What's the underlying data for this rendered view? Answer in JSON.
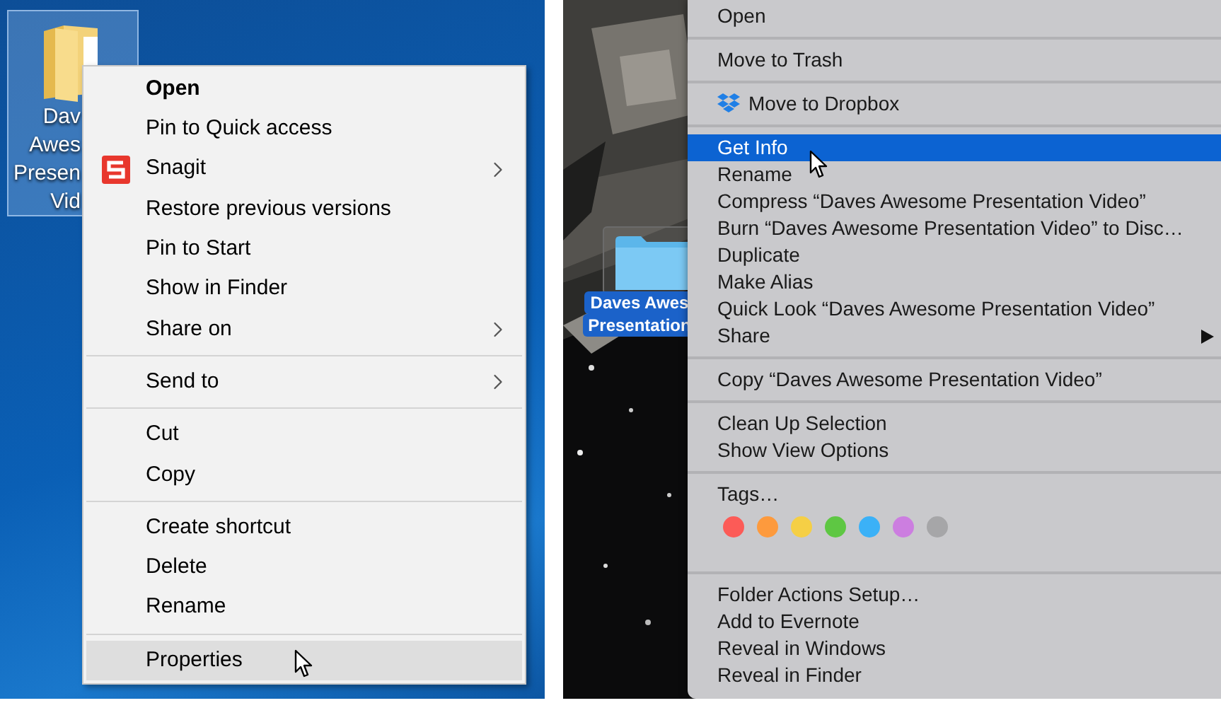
{
  "windows": {
    "desktop_icon": {
      "selected": true,
      "label_lines": [
        "Dav",
        "Awes",
        "Presen",
        "Vid"
      ]
    },
    "menu": {
      "items": [
        {
          "kind": "item",
          "label": "Open",
          "bold": true,
          "has_icon": false,
          "submenu": false,
          "selected": false
        },
        {
          "kind": "item",
          "label": "Pin to Quick access",
          "bold": false,
          "has_icon": false,
          "submenu": false,
          "selected": false
        },
        {
          "kind": "item",
          "label": "Snagit",
          "bold": false,
          "has_icon": true,
          "submenu": true,
          "selected": false
        },
        {
          "kind": "item",
          "label": "Restore previous versions",
          "bold": false,
          "has_icon": false,
          "submenu": false,
          "selected": false
        },
        {
          "kind": "item",
          "label": "Pin to Start",
          "bold": false,
          "has_icon": false,
          "submenu": false,
          "selected": false
        },
        {
          "kind": "item",
          "label": "Show in Finder",
          "bold": false,
          "has_icon": false,
          "submenu": false,
          "selected": false
        },
        {
          "kind": "item",
          "label": "Share on",
          "bold": false,
          "has_icon": false,
          "submenu": true,
          "selected": false
        },
        {
          "kind": "separator"
        },
        {
          "kind": "item",
          "label": "Send to",
          "bold": false,
          "has_icon": false,
          "submenu": true,
          "selected": false
        },
        {
          "kind": "separator"
        },
        {
          "kind": "item",
          "label": "Cut",
          "bold": false,
          "has_icon": false,
          "submenu": false,
          "selected": false
        },
        {
          "kind": "item",
          "label": "Copy",
          "bold": false,
          "has_icon": false,
          "submenu": false,
          "selected": false
        },
        {
          "kind": "separator"
        },
        {
          "kind": "item",
          "label": "Create shortcut",
          "bold": false,
          "has_icon": false,
          "submenu": false,
          "selected": false
        },
        {
          "kind": "item",
          "label": "Delete",
          "bold": false,
          "has_icon": false,
          "submenu": false,
          "selected": false
        },
        {
          "kind": "item",
          "label": "Rename",
          "bold": false,
          "has_icon": false,
          "submenu": false,
          "selected": false
        },
        {
          "kind": "separator"
        },
        {
          "kind": "item",
          "label": "Properties",
          "bold": false,
          "has_icon": false,
          "submenu": false,
          "selected": true
        }
      ]
    }
  },
  "mac": {
    "desktop_icon": {
      "selected": true,
      "label_lines": [
        "Daves Awes",
        "Presentation"
      ]
    },
    "menu": {
      "items": [
        {
          "kind": "item",
          "label": "Open",
          "has_icon": false,
          "submenu": false,
          "selected": false
        },
        {
          "kind": "separator"
        },
        {
          "kind": "item",
          "label": "Move to Trash",
          "has_icon": false,
          "submenu": false,
          "selected": false
        },
        {
          "kind": "separator"
        },
        {
          "kind": "item",
          "label": "Move to Dropbox",
          "has_icon": true,
          "submenu": false,
          "selected": false
        },
        {
          "kind": "separator"
        },
        {
          "kind": "item",
          "label": "Get Info",
          "has_icon": false,
          "submenu": false,
          "selected": true
        },
        {
          "kind": "item",
          "label": "Rename",
          "has_icon": false,
          "submenu": false,
          "selected": false
        },
        {
          "kind": "item",
          "label": "Compress “Daves Awesome Presentation Video”",
          "has_icon": false,
          "submenu": false,
          "selected": false
        },
        {
          "kind": "item",
          "label": "Burn “Daves Awesome Presentation Video” to Disc…",
          "has_icon": false,
          "submenu": false,
          "selected": false
        },
        {
          "kind": "item",
          "label": "Duplicate",
          "has_icon": false,
          "submenu": false,
          "selected": false
        },
        {
          "kind": "item",
          "label": "Make Alias",
          "has_icon": false,
          "submenu": false,
          "selected": false
        },
        {
          "kind": "item",
          "label": "Quick Look “Daves Awesome Presentation Video”",
          "has_icon": false,
          "submenu": false,
          "selected": false
        },
        {
          "kind": "item",
          "label": "Share",
          "has_icon": false,
          "submenu": true,
          "selected": false
        },
        {
          "kind": "separator"
        },
        {
          "kind": "item",
          "label": "Copy “Daves Awesome Presentation Video”",
          "has_icon": false,
          "submenu": false,
          "selected": false
        },
        {
          "kind": "separator"
        },
        {
          "kind": "item",
          "label": "Clean Up Selection",
          "has_icon": false,
          "submenu": false,
          "selected": false
        },
        {
          "kind": "item",
          "label": "Show View Options",
          "has_icon": false,
          "submenu": false,
          "selected": false
        },
        {
          "kind": "separator"
        },
        {
          "kind": "item",
          "label": "Tags…",
          "has_icon": false,
          "submenu": false,
          "selected": false
        },
        {
          "kind": "tags",
          "colors": [
            {
              "color": "#fc5b57"
            },
            {
              "color": "#fd9a3d"
            },
            {
              "color": "#f5cf45"
            },
            {
              "color": "#5ec743"
            },
            {
              "color": "#3bb1f7"
            },
            {
              "color": "#cc7ee0"
            },
            {
              "color": "#a6a6a8"
            }
          ]
        },
        {
          "kind": "separator"
        },
        {
          "kind": "item",
          "label": "Folder Actions Setup…",
          "has_icon": false,
          "submenu": false,
          "selected": false
        },
        {
          "kind": "item",
          "label": "Add to Evernote",
          "has_icon": false,
          "submenu": false,
          "selected": false
        },
        {
          "kind": "item",
          "label": "Reveal in Windows",
          "has_icon": false,
          "submenu": false,
          "selected": false
        },
        {
          "kind": "item",
          "label": "Reveal in Finder",
          "has_icon": false,
          "submenu": false,
          "selected": false
        }
      ]
    }
  }
}
